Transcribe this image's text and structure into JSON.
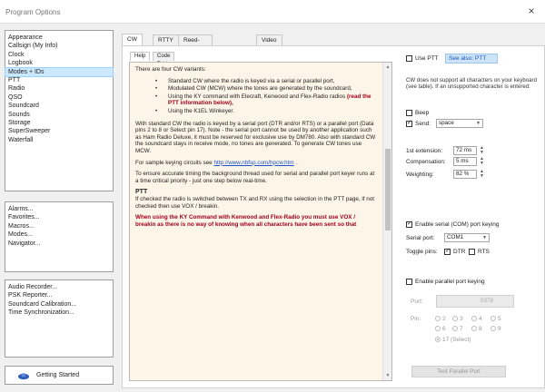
{
  "window": {
    "title": "Program Options",
    "close": "×"
  },
  "nav_main": [
    "Appearance",
    "Callsign (My Info)",
    "Clock",
    "Logbook",
    "Modes + IDs",
    "PTT",
    "Radio",
    "QSO",
    "Soundcard",
    "Sounds",
    "Storage",
    "SuperSweeper",
    "Waterfall"
  ],
  "nav_main_selected": "Modes + IDs",
  "nav_more": [
    "Alarms...",
    "Favorites...",
    "Macros...",
    "Modes...",
    "Navigator..."
  ],
  "nav_tools": [
    "Audio Recorder...",
    "PSK Reporter...",
    "Soundcard Calibration...",
    "Time Synchronization..."
  ],
  "getting_started": "Getting Started",
  "tabs": [
    "CW",
    "RTTY",
    "Reed-Solomon (RSID)",
    "Video ID"
  ],
  "subtabs": [
    "Help",
    "Code Table"
  ],
  "help": {
    "intro": "There are four CW variants:",
    "b1": "Standard CW where the radio is keyed via a serial or parallel port,",
    "b2": "Modulated CW (MCW) where the tones are generated by the soundcard,",
    "b3_pre": "Using the KY command with Elecraft, Kenwood and Flex-Radio radios ",
    "b3_red": "(read the PTT information below),",
    "b4": "Using the K1EL Winkeyer.",
    "p1": "With standard CW the radio is keyed by a serial port (DTR and/or RTS) or a parallel port (Data pins 2 to 8 or Select pin 17). Note - the serial port cannot be used by another application such as Ham Radio Deluxe, it must be reserved for exclusive use by DM780. Also with standard CW the soundcard stays in receive mode, no tones are generated. To generate CW tones use MCW.",
    "p2_label": "For sample keying circuits see",
    "p2_link": "http://www.nbfsp.com/hpcw.htm",
    "p2_after": ".",
    "p3": "To ensure accurate timing the background thread used for serial and parallel port keyer runs at a time critical priority - just one step below real-time.",
    "ptt_heading": "PTT",
    "p4": "If checked the radio is switched between TX and RX using the selection in the PTT page, if not checked then use VOX / breakin.",
    "red_block": "When using the KY Command with Kenwood and Flex-Radio you must use VOX / breakin as there is no way of knowing when all characters have been sent so that"
  },
  "options": {
    "use_ptt": "Use PTT",
    "see_also": "See also: PTT",
    "note": "CW does not support all characters on your keyboard (see table). If an unsupported character is entered:",
    "beep": "Beep",
    "send": "Send:",
    "send_value": "space",
    "first_ext_label": "1st extension:",
    "first_ext_value": "72 ms",
    "comp_label": "Compensation:",
    "comp_value": "5 ms",
    "weight_label": "Weighting:",
    "weight_value": "82 %",
    "enable_serial": "Enable serial (COM) port keying",
    "serial_port_label": "Serial port:",
    "serial_port_value": "COM1",
    "toggle_pins_label": "Toggle pins:",
    "dtr": "DTR",
    "rts": "RTS",
    "enable_parallel": "Enable parallel port keying",
    "port_label": "Port:",
    "port_value": "0378",
    "pin_label": "Pin:",
    "pins": [
      "2",
      "3",
      "4",
      "5",
      "6",
      "7",
      "8",
      "9"
    ],
    "pin17": "17 (Select)",
    "test_button": "Test Parallel Port"
  }
}
